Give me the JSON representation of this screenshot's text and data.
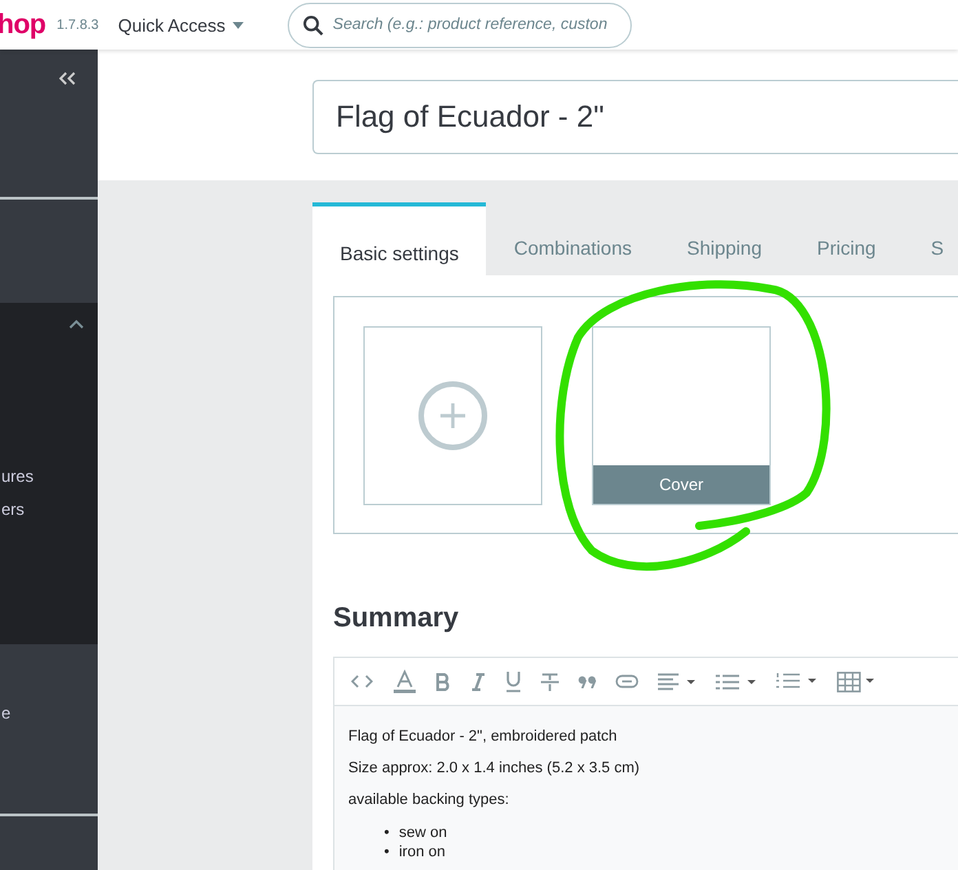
{
  "header": {
    "logo": "hop",
    "version": "1.7.8.3",
    "quick_access": "Quick Access",
    "search": {
      "placeholder": "Search (e.g.: product reference, custon"
    }
  },
  "sidebar": {
    "expanded_section": {
      "expanded": true,
      "items": [
        "ures",
        "ers"
      ]
    },
    "lower_section": {
      "items": [
        "e"
      ]
    }
  },
  "product_name": {
    "value": "Flag of Ecuador - 2\""
  },
  "tabs": [
    {
      "label": "Basic settings",
      "selected": true
    },
    {
      "label": "Combinations",
      "selected": false
    },
    {
      "label": "Shipping",
      "selected": false
    },
    {
      "label": "Pricing",
      "selected": false
    },
    {
      "label": "S",
      "selected": false
    }
  ],
  "images": [
    {
      "kind": "add"
    },
    {
      "kind": "image",
      "label": "Cover"
    }
  ],
  "summary": {
    "title": "Summary",
    "paragraphs": [
      "Flag of Ecuador - 2\", embroidered patch",
      "Size approx: 2.0 x 1.4 inches (5.2 x 3.5 cm)",
      "available backing types:"
    ],
    "list_marker": "•",
    "list": [
      "sew on",
      "iron on"
    ]
  }
}
